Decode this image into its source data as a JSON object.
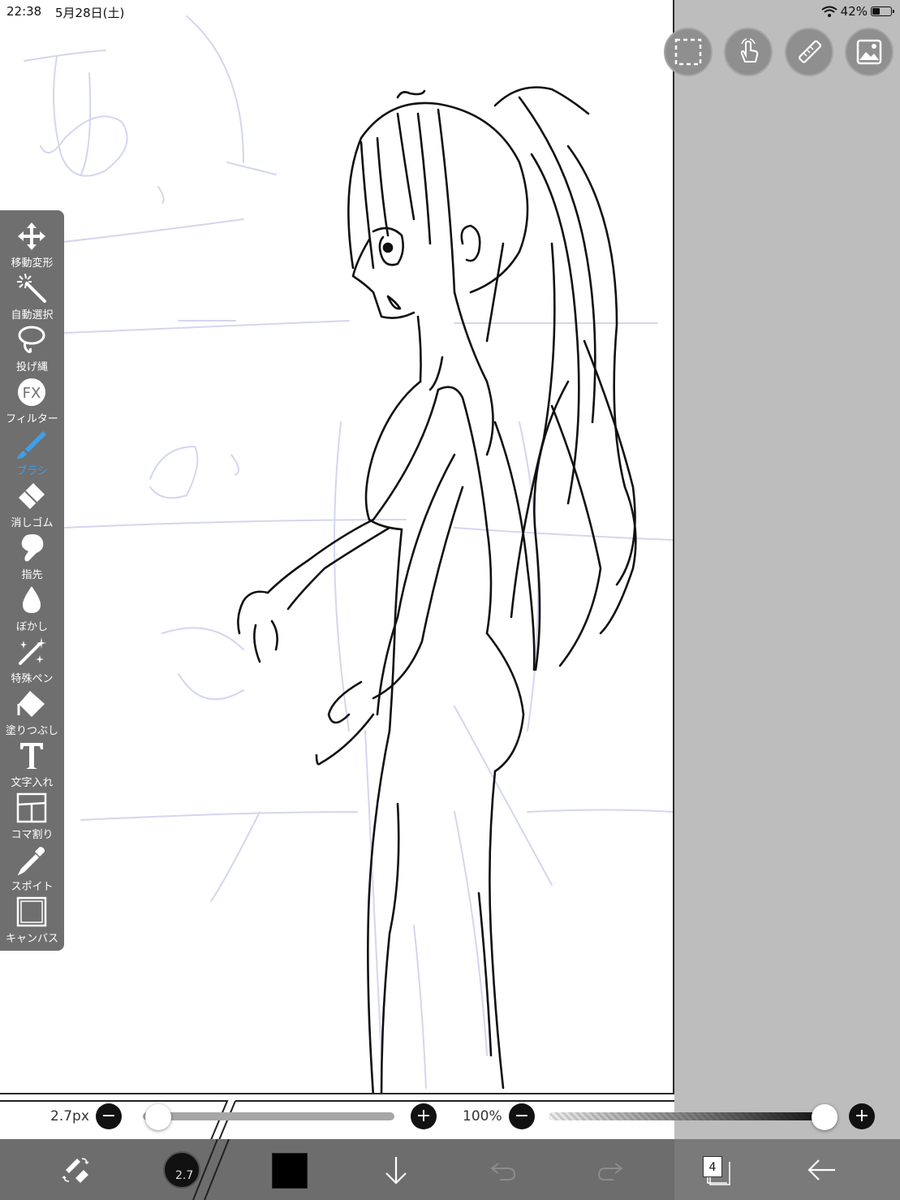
{
  "status": {
    "time": "22:38",
    "date": "5月28日(土)",
    "battery_pct": "42%",
    "battery_level": 0.42
  },
  "top_buttons": [
    "selection-icon",
    "touch-gesture-icon",
    "ruler-icon",
    "material-image-icon"
  ],
  "tools": [
    {
      "id": "move",
      "label": "移動変形",
      "icon": "move-transform-icon"
    },
    {
      "id": "auto-select",
      "label": "自動選択",
      "icon": "magic-wand-icon"
    },
    {
      "id": "lasso",
      "label": "投げ縄",
      "icon": "lasso-icon"
    },
    {
      "id": "filter",
      "label": "フィルター",
      "icon": "fx-icon"
    },
    {
      "id": "brush",
      "label": "ブラシ",
      "icon": "brush-icon",
      "active": true
    },
    {
      "id": "eraser",
      "label": "消しゴム",
      "icon": "eraser-icon"
    },
    {
      "id": "finger",
      "label": "指先",
      "icon": "finger-icon"
    },
    {
      "id": "blur",
      "label": "ぼかし",
      "icon": "blur-drop-icon"
    },
    {
      "id": "special-pen",
      "label": "特殊ペン",
      "icon": "special-pen-icon"
    },
    {
      "id": "fill",
      "label": "塗りつぶし",
      "icon": "fill-bucket-icon"
    },
    {
      "id": "text",
      "label": "文字入れ",
      "icon": "text-icon"
    },
    {
      "id": "panel",
      "label": "コマ割り",
      "icon": "panel-divide-icon"
    },
    {
      "id": "eyedropper",
      "label": "スポイト",
      "icon": "eyedropper-icon"
    },
    {
      "id": "canvas",
      "label": "キャンバス",
      "icon": "canvas-icon"
    }
  ],
  "sliders": {
    "size_label": "2.7px",
    "size_fraction": 0.01,
    "opacity_label": "100%",
    "opacity_fraction": 1.0,
    "minus": "−",
    "plus": "+"
  },
  "bottom": {
    "brush_size": "2.7",
    "color": "#000000",
    "layer_count": "4"
  },
  "colors": {
    "accent": "#3e9fe9",
    "toolbar": "#6f6f6f",
    "side_gray": "#bdbdbd"
  }
}
